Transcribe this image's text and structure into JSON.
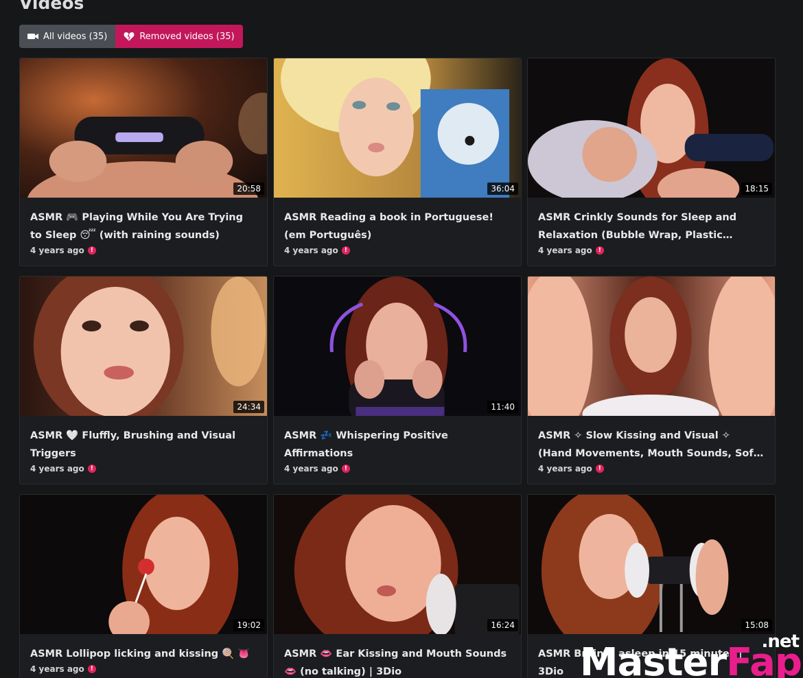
{
  "section": {
    "title": "Videos"
  },
  "tabs": {
    "all": {
      "label": "All videos (35)",
      "icon": "video-camera-icon"
    },
    "removed": {
      "label": "Removed videos (35)",
      "icon": "broken-heart-icon"
    }
  },
  "colors": {
    "accent": "#c2185b",
    "tab_inactive": "#4b4e54",
    "alert": "#e0245e",
    "background": "#161719"
  },
  "videos": [
    {
      "title": "ASMR 🎮 Playing While You Are Trying to Sleep 😴 (with raining sounds)",
      "duration": "20:58",
      "age": "4 years ago"
    },
    {
      "title": "ASMR Reading a book in Portuguese! (em Português)",
      "duration": "36:04",
      "age": "4 years ago"
    },
    {
      "title": "ASMR Crinkly Sounds for Sleep and Relaxation (Bubble Wrap, Plastic Triggers)",
      "duration": "18:15",
      "age": "4 years ago"
    },
    {
      "title": "ASMR 🤍 Fluffly, Brushing and Visual Triggers",
      "duration": "24:34",
      "age": "4 years ago"
    },
    {
      "title": "ASMR 💤 Whispering Positive Affirmations",
      "duration": "11:40",
      "age": "4 years ago"
    },
    {
      "title": "ASMR ✧ Slow Kissing and Visual ✧ (Hand Movements, Mouth Sounds, Soft Breathing)",
      "duration": "",
      "age": "4 years ago"
    },
    {
      "title": "ASMR Lollipop licking and kissing 🍭 👅",
      "duration": "19:02",
      "age": "4 years ago"
    },
    {
      "title": "ASMR 👄 Ear Kissing and Mouth Sounds 👄 (no talking) | 3Dio",
      "duration": "16:24",
      "age": ""
    },
    {
      "title": "ASMR Brain... asleep in 15 minutes | 3Dio",
      "duration": "15:08",
      "age": ""
    }
  ],
  "watermark": {
    "part1": "Master",
    "part2": "Fap",
    "tld": ".net"
  }
}
